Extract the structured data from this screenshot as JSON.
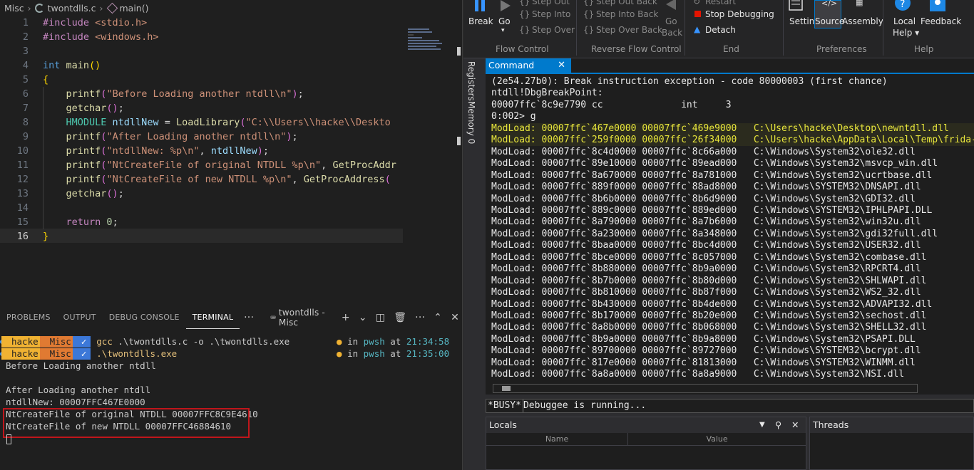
{
  "breadcrumb": {
    "folder": "Misc",
    "file": "twontdlls.c",
    "symbol": "main()"
  },
  "editor": {
    "line_numbers": [
      "1",
      "2",
      "3",
      "4",
      "5",
      "6",
      "7",
      "8",
      "9",
      "10",
      "11",
      "12",
      "13",
      "14",
      "15",
      "16"
    ],
    "lines": [
      [
        [
          "p",
          "#include "
        ],
        [
          "s",
          "<stdio.h>"
        ]
      ],
      [
        [
          "p",
          "#include "
        ],
        [
          "s",
          "<windows.h>"
        ]
      ],
      [],
      [
        [
          "k",
          "int "
        ],
        [
          "f",
          "main"
        ],
        [
          "b",
          "()"
        ]
      ],
      [
        [
          "b",
          "{"
        ]
      ],
      [
        [
          "",
          "    "
        ],
        [
          "f",
          "printf"
        ],
        [
          "b2",
          "("
        ],
        [
          "s",
          "\"Before Loading another ntdll\\n\""
        ],
        [
          "b2",
          ")"
        ],
        [
          "",
          ";"
        ]
      ],
      [
        [
          "",
          "    "
        ],
        [
          "f",
          "getchar"
        ],
        [
          "b2",
          "()"
        ],
        [
          "",
          ";"
        ]
      ],
      [
        [
          "",
          "    "
        ],
        [
          "t",
          "HMODULE "
        ],
        [
          "v",
          "ntdllNew"
        ],
        [
          "",
          " = "
        ],
        [
          "f",
          "LoadLibrary"
        ],
        [
          "b2",
          "("
        ],
        [
          "s",
          "\"C:\\\\Users\\\\hacke\\\\Deskto"
        ]
      ],
      [
        [
          "",
          "    "
        ],
        [
          "f",
          "printf"
        ],
        [
          "b2",
          "("
        ],
        [
          "s",
          "\"After Loading another ntdll\\n\""
        ],
        [
          "b2",
          ")"
        ],
        [
          "",
          ";"
        ]
      ],
      [
        [
          "",
          "    "
        ],
        [
          "f",
          "printf"
        ],
        [
          "b2",
          "("
        ],
        [
          "s",
          "\"ntdllNew: %p\\n\""
        ],
        [
          "",
          ", "
        ],
        [
          "v",
          "ntdllNew"
        ],
        [
          "b2",
          ")"
        ],
        [
          "",
          ";"
        ]
      ],
      [
        [
          "",
          "    "
        ],
        [
          "f",
          "printf"
        ],
        [
          "b2",
          "("
        ],
        [
          "s",
          "\"NtCreateFile of original NTDLL %p\\n\""
        ],
        [
          "",
          ", "
        ],
        [
          "f",
          "GetProcAddr"
        ]
      ],
      [
        [
          "",
          "    "
        ],
        [
          "f",
          "printf"
        ],
        [
          "b2",
          "("
        ],
        [
          "s",
          "\"NtCreateFile of new NTDLL %p\\n\""
        ],
        [
          "",
          ", "
        ],
        [
          "f",
          "GetProcAddress"
        ],
        [
          "b2",
          "("
        ]
      ],
      [
        [
          "",
          "    "
        ],
        [
          "f",
          "getchar"
        ],
        [
          "b2",
          "()"
        ],
        [
          "",
          ";"
        ]
      ],
      [],
      [
        [
          "",
          "    "
        ],
        [
          "p",
          "return "
        ],
        [
          "n",
          "0"
        ],
        [
          "",
          ";"
        ]
      ],
      [
        [
          "b",
          "}"
        ]
      ]
    ]
  },
  "panel": {
    "tabs": [
      "PROBLEMS",
      "OUTPUT",
      "DEBUG CONSOLE",
      "TERMINAL"
    ],
    "more": "···",
    "terminal_instance": "twontdlls - Misc",
    "add": "+"
  },
  "terminal": {
    "prompts": [
      {
        "user": "hacke",
        "dir": "Misc",
        "cmd": "gcc .\\twontdlls.c -o .\\twontdlls.exe",
        "shell": "pwsh",
        "time": "21:34:58"
      },
      {
        "user": "hacke",
        "dir": "Misc",
        "cmd": ".\\twontdlls.exe",
        "shell": "pwsh",
        "time": "21:35:00"
      }
    ],
    "in_label": "in",
    "at_label": "at",
    "output": [
      "Before Loading another ntdll",
      "",
      "After Loading another ntdll",
      "ntdllNew: 00007FFC467E0000",
      "NtCreateFile of original NTDLL 00007FFC8C9E4610",
      "NtCreateFile of new NTDLL 00007FFC46884610"
    ]
  },
  "ribbon": {
    "break": "Break",
    "go": "Go",
    "step_out": "Step Out",
    "step_into": "Step Into",
    "step_over": "Step Over",
    "step_out_back": "Step Out Back",
    "step_into_back": "Step Into Back",
    "step_over_back": "Step Over Back",
    "go_back_1": "Go",
    "go_back_2": "Back",
    "restart": "Restart",
    "stop": "Stop Debugging",
    "detach": "Detach",
    "settings": "Settings",
    "source": "Source",
    "assembly": "Assembly",
    "local_help_1": "Local",
    "local_help_2": "Help ▾",
    "feedback": "Feedback",
    "groups": {
      "flow": "Flow Control",
      "reverse": "Reverse Flow Control",
      "end": "End",
      "prefs": "Preferences",
      "help": "Help"
    }
  },
  "side_tabs": {
    "registers": "Registers",
    "memory": "Memory 0"
  },
  "command": {
    "tab_label": "Command",
    "close": "✕",
    "lines": [
      {
        "text": "(2e54.27b0): Break instruction exception - code 80000003 (first chance)",
        "hl": false
      },
      {
        "text": "ntdll!DbgBreakPoint:",
        "hl": false
      },
      {
        "text": "00007ffc`8c9e7790 cc              int     3",
        "hl": false
      },
      {
        "text": "0:002> g",
        "hl": false
      },
      {
        "text": "ModLoad: 00007ffc`467e0000 00007ffc`469e9000   C:\\Users\\hacke\\Desktop\\newntdll.dll",
        "hl": true
      },
      {
        "text": "ModLoad: 00007ffc`259f0000 00007ffc`26f34000   C:\\Users\\hacke\\AppData\\Local\\Temp\\frida-8",
        "hl": true
      },
      {
        "text": "ModLoad: 00007ffc`8c4d0000 00007ffc`8c66a000   C:\\Windows\\System32\\ole32.dll",
        "hl": false
      },
      {
        "text": "ModLoad: 00007ffc`89e10000 00007ffc`89ead000   C:\\Windows\\System32\\msvcp_win.dll",
        "hl": false
      },
      {
        "text": "ModLoad: 00007ffc`8a670000 00007ffc`8a781000   C:\\Windows\\System32\\ucrtbase.dll",
        "hl": false
      },
      {
        "text": "ModLoad: 00007ffc`889f0000 00007ffc`88ad8000   C:\\Windows\\SYSTEM32\\DNSAPI.dll",
        "hl": false
      },
      {
        "text": "ModLoad: 00007ffc`8b6b0000 00007ffc`8b6d9000   C:\\Windows\\System32\\GDI32.dll",
        "hl": false
      },
      {
        "text": "ModLoad: 00007ffc`889c0000 00007ffc`889ed000   C:\\Windows\\SYSTEM32\\IPHLPAPI.DLL",
        "hl": false
      },
      {
        "text": "ModLoad: 00007ffc`8a790000 00007ffc`8a7b6000   C:\\Windows\\System32\\win32u.dll",
        "hl": false
      },
      {
        "text": "ModLoad: 00007ffc`8a230000 00007ffc`8a348000   C:\\Windows\\System32\\gdi32full.dll",
        "hl": false
      },
      {
        "text": "ModLoad: 00007ffc`8baa0000 00007ffc`8bc4d000   C:\\Windows\\System32\\USER32.dll",
        "hl": false
      },
      {
        "text": "ModLoad: 00007ffc`8bce0000 00007ffc`8c057000   C:\\Windows\\System32\\combase.dll",
        "hl": false
      },
      {
        "text": "ModLoad: 00007ffc`8b880000 00007ffc`8b9a0000   C:\\Windows\\System32\\RPCRT4.dll",
        "hl": false
      },
      {
        "text": "ModLoad: 00007ffc`8b7b0000 00007ffc`8b80d000   C:\\Windows\\System32\\SHLWAPI.dll",
        "hl": false
      },
      {
        "text": "ModLoad: 00007ffc`8b810000 00007ffc`8b87f000   C:\\Windows\\System32\\WS2_32.dll",
        "hl": false
      },
      {
        "text": "ModLoad: 00007ffc`8b430000 00007ffc`8b4de000   C:\\Windows\\System32\\ADVAPI32.dll",
        "hl": false
      },
      {
        "text": "ModLoad: 00007ffc`8b170000 00007ffc`8b20e000   C:\\Windows\\System32\\sechost.dll",
        "hl": false
      },
      {
        "text": "ModLoad: 00007ffc`8a8b0000 00007ffc`8b068000   C:\\Windows\\System32\\SHELL32.dll",
        "hl": false
      },
      {
        "text": "ModLoad: 00007ffc`8b9a0000 00007ffc`8b9a8000   C:\\Windows\\System32\\PSAPI.DLL",
        "hl": false
      },
      {
        "text": "ModLoad: 00007ffc`89700000 00007ffc`89727000   C:\\Windows\\SYSTEM32\\bcrypt.dll",
        "hl": false
      },
      {
        "text": "ModLoad: 00007ffc`817e0000 00007ffc`81813000   C:\\Windows\\SYSTEM32\\WINMM.dll",
        "hl": false
      },
      {
        "text": "ModLoad: 00007ffc`8a8a0000 00007ffc`8a8a9000   C:\\Windows\\System32\\NSI.dll",
        "hl": false
      }
    ],
    "busy_tag": "*BUSY*",
    "status": "Debuggee is running..."
  },
  "locals": {
    "title": "Locals",
    "col_name": "Name",
    "col_value": "Value"
  },
  "threads": {
    "title": "Threads"
  }
}
